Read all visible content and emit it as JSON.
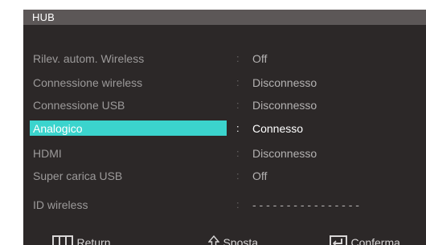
{
  "header": {
    "title": "HUB"
  },
  "rows": [
    {
      "label": "Rilev. autom. Wireless",
      "sep": ":",
      "value": "Off",
      "selected": false
    },
    {
      "label": "Connessione wireless",
      "sep": ":",
      "value": "Disconnesso",
      "selected": false
    },
    {
      "label": "Connessione USB",
      "sep": ":",
      "value": "Disconnesso",
      "selected": false
    },
    {
      "label": "Analogico",
      "sep": ":",
      "value": "Connesso",
      "selected": true
    },
    {
      "label": "HDMI",
      "sep": ":",
      "value": "Disconnesso",
      "selected": false
    },
    {
      "label": "Super carica USB",
      "sep": ":",
      "value": "Off",
      "selected": false
    },
    {
      "label": "ID wireless",
      "sep": ":",
      "value": "- - - - - - - - - - - - - - - -",
      "selected": false
    }
  ],
  "footer": {
    "return_label": "Return",
    "return_icon": "return-grid-icon",
    "move_label": "Sposta",
    "move_icon": "move-arrows-icon",
    "confirm_label": "Conferma",
    "confirm_icon": "enter-icon"
  },
  "colors": {
    "background": "#2c2828",
    "header": "#5c5757",
    "highlight": "#3bd4cd",
    "text_dim": "#9c9a9a",
    "text_selected": "#ffffff"
  }
}
